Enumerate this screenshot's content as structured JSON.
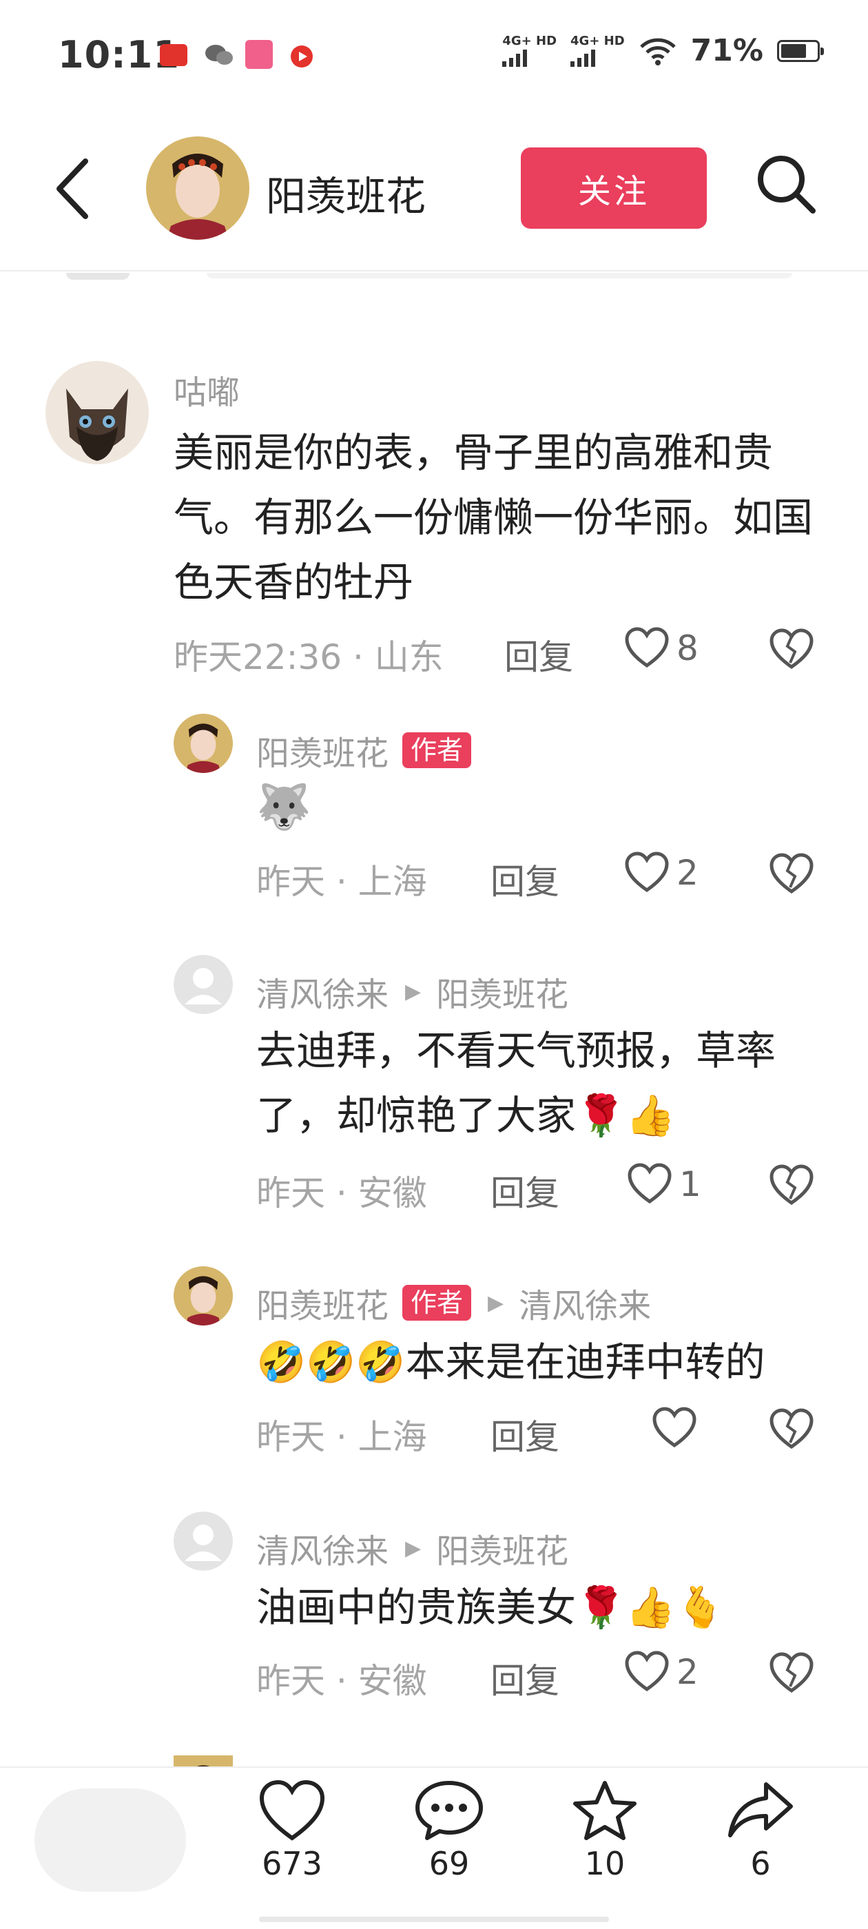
{
  "status_bar": {
    "time": "10:11",
    "net1": "4G+ HD",
    "net2": "4G+ HD",
    "battery": "71%",
    "battery_level": 0.71,
    "app_icons": [
      "toutiao-icon",
      "wechat-icon",
      "bilibili-icon",
      "red-play-icon"
    ]
  },
  "header": {
    "name": "阳羡班花",
    "follow_label": "关注"
  },
  "comments": [
    {
      "user": "咕嘟",
      "text": "美丽是你的表，骨子里的高雅和贵气。有那么一份慵懒一份华丽。如国色天香的牡丹",
      "meta": "昨天22:36 · 山东",
      "reply_label": "回复",
      "likes": "8"
    },
    {
      "user": "阳羡班花",
      "badge": "作者",
      "emoji": "🐺",
      "meta": "昨天 · 上海",
      "reply_label": "回复",
      "likes": "2"
    },
    {
      "user": "清风徐来",
      "reply_to": "阳羡班花",
      "text": "去迪拜，不看天气预报，草率了，却惊艳了大家🌹👍",
      "meta": "昨天 · 安徽",
      "reply_label": "回复",
      "likes": "1"
    },
    {
      "user": "阳羡班花",
      "badge": "作者",
      "reply_to": "清风徐来",
      "text": "🤣🤣🤣本来是在迪拜中转的",
      "meta": "昨天 · 上海",
      "reply_label": "回复",
      "likes": ""
    },
    {
      "user": "清风徐来",
      "reply_to": "阳羡班花",
      "text": "油画中的贵族美女🌹👍🫰",
      "meta": "昨天 · 安徽",
      "reply_label": "回复",
      "likes": "2"
    }
  ],
  "bottom_bar": {
    "likes": "673",
    "comments": "69",
    "favorites": "10",
    "shares": "6"
  },
  "colors": {
    "accent": "#ea3f5d",
    "secondary_text": "#9b9b9b"
  }
}
